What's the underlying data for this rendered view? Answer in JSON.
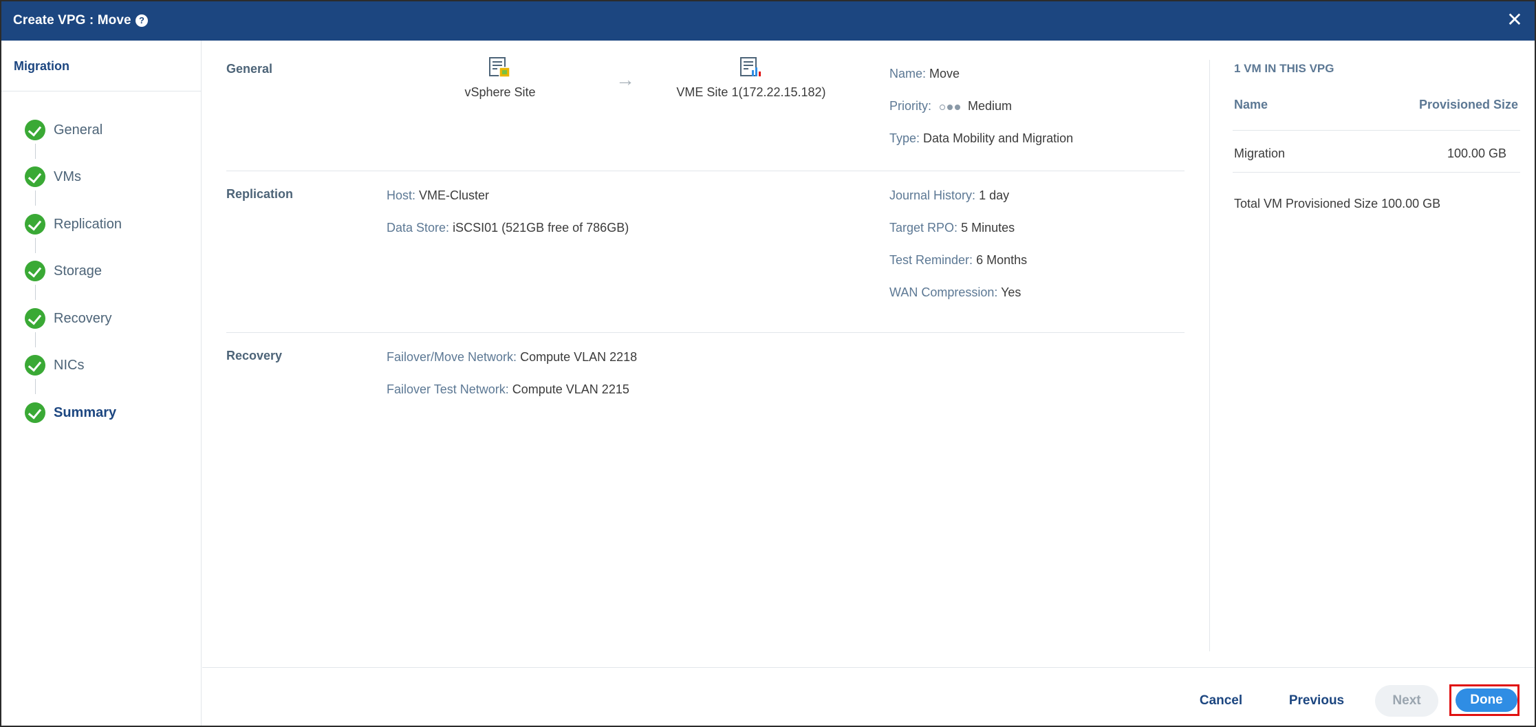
{
  "window": {
    "title": "Create VPG : Move",
    "help_glyph": "?",
    "close_glyph": "✕"
  },
  "sidebar": {
    "heading": "Migration",
    "steps": [
      {
        "label": "General"
      },
      {
        "label": "VMs"
      },
      {
        "label": "Replication"
      },
      {
        "label": "Storage"
      },
      {
        "label": "Recovery"
      },
      {
        "label": "NICs"
      },
      {
        "label": "Summary"
      }
    ]
  },
  "general": {
    "section_title": "General",
    "source_site": "vSphere Site",
    "target_site": "VME Site 1(172.22.15.182)",
    "arrow_glyph": "→",
    "name_key": "Name:",
    "name_value": "Move",
    "priority_key": "Priority:",
    "priority_value": "Medium",
    "type_key": "Type:",
    "type_value": "Data Mobility and Migration"
  },
  "replication": {
    "section_title": "Replication",
    "host_key": "Host:",
    "host_value": "VME-Cluster",
    "datastore_key": "Data Store:",
    "datastore_value": "iSCSI01 (521GB free of 786GB)",
    "journal_key": "Journal History:",
    "journal_value": "1 day",
    "rpo_key": "Target RPO:",
    "rpo_value": "5 Minutes",
    "reminder_key": "Test Reminder:",
    "reminder_value": "6 Months",
    "wan_key": "WAN Compression:",
    "wan_value": "Yes"
  },
  "recovery": {
    "section_title": "Recovery",
    "failover_key": "Failover/Move Network:",
    "failover_value": "Compute VLAN 2218",
    "test_key": "Failover Test Network:",
    "test_value": "Compute VLAN 2215"
  },
  "vm_panel": {
    "title": "1 VM IN THIS VPG",
    "col_name": "Name",
    "col_size": "Provisioned Size",
    "rows": [
      {
        "name": "Migration",
        "size": "100.00 GB"
      }
    ],
    "total": "Total VM Provisioned Size 100.00 GB"
  },
  "footer": {
    "cancel": "Cancel",
    "previous": "Previous",
    "next": "Next",
    "done": "Done"
  },
  "colors": {
    "titlebar": "#1c4680",
    "check": "#3aa935",
    "primary_button": "#2f8de4",
    "highlight_border": "#e01010"
  }
}
